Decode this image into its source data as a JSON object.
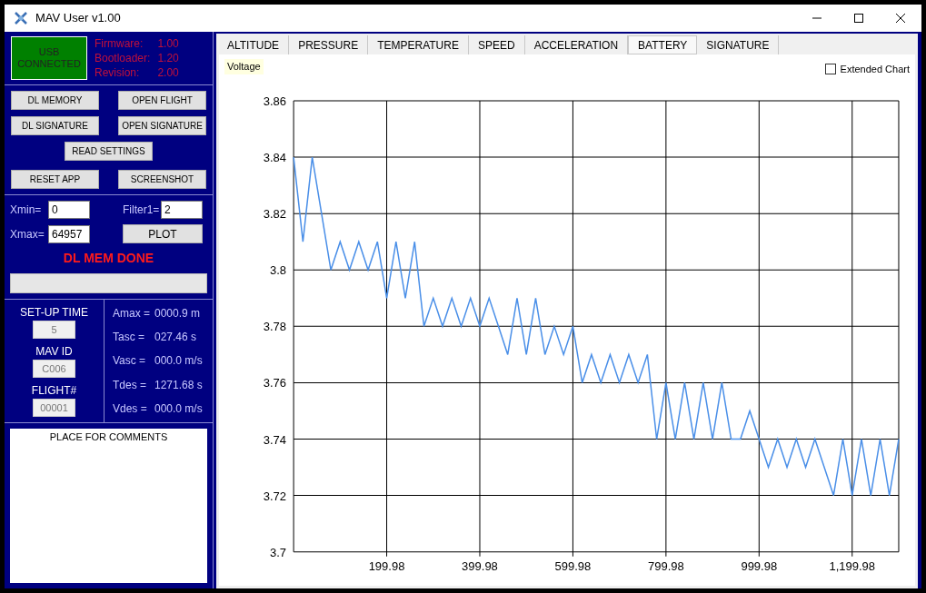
{
  "window": {
    "title": "MAV User v1.00"
  },
  "device": {
    "status": "USB CONNECTED",
    "connected": true
  },
  "versions": [
    {
      "label": "Firmware:",
      "value": "1.00"
    },
    {
      "label": "Bootloader:",
      "value": "1.20"
    },
    {
      "label": "Revision:",
      "value": "2.00"
    }
  ],
  "buttons": [
    [
      "DL MEMORY",
      "OPEN FLIGHT"
    ],
    [
      "DL SIGNATURE",
      "OPEN SIGNATURE"
    ],
    [
      "READ SETTINGS"
    ],
    [
      "RESET APP",
      "SCREENSHOT"
    ]
  ],
  "plot_settings": {
    "xmin": {
      "label": "Xmin=",
      "value": "0"
    },
    "xmax": {
      "label": "Xmax=",
      "value": "64957"
    },
    "filter": {
      "label": "Filter1=",
      "value": "2"
    },
    "plot_button": "PLOT"
  },
  "status_message": "DL MEM DONE",
  "progress": {
    "level": 0
  },
  "settings": [
    {
      "label": "SET-UP TIME",
      "value": "5",
      "disabled": true
    },
    {
      "label": "MAV ID",
      "value": "C006",
      "disabled": true
    },
    {
      "label": "FLIGHT#",
      "value": "00001",
      "disabled": true
    }
  ],
  "results": [
    {
      "label": "Amax =",
      "value": "0000.9 m"
    },
    {
      "label": "Tasc =",
      "value": "027.46 s"
    },
    {
      "label": "Vasc =",
      "value": "000.0 m/s"
    },
    {
      "label": "Tdes =",
      "value": "1271.68 s"
    },
    {
      "label": "Vdes =",
      "value": "000.0 m/s"
    }
  ],
  "comments": {
    "title": "PLACE FOR COMMENTS"
  },
  "tabs": [
    {
      "label": "ALTITUDE",
      "selected": false
    },
    {
      "label": "PRESSURE",
      "selected": false
    },
    {
      "label": "TEMPERATURE",
      "selected": false
    },
    {
      "label": "SPEED",
      "selected": false
    },
    {
      "label": "ACCELERATION",
      "selected": false
    },
    {
      "label": "BATTERY",
      "selected": true
    },
    {
      "label": "SIGNATURE",
      "selected": false
    }
  ],
  "chart": {
    "extended_chart": {
      "label": "Extended Chart",
      "checked": false
    },
    "chart_data": {
      "type": "line",
      "x": [
        0,
        20,
        40,
        60,
        80,
        100,
        120,
        140,
        160,
        180,
        200,
        220,
        240,
        260,
        280,
        300,
        320,
        340,
        360,
        380,
        400,
        420,
        440,
        460,
        480,
        500,
        520,
        540,
        560,
        580,
        600,
        620,
        640,
        660,
        680,
        700,
        720,
        740,
        760,
        780,
        800,
        820,
        840,
        860,
        880,
        900,
        920,
        940,
        960,
        980,
        1000,
        1020,
        1040,
        1060,
        1080,
        1100,
        1120,
        1140,
        1160,
        1180,
        1200,
        1220,
        1240,
        1260,
        1280,
        1300
      ],
      "series": [
        {
          "name": "Voltage",
          "color": "#4a8fe8",
          "values": [
            3.84,
            3.81,
            3.84,
            3.82,
            3.8,
            3.81,
            3.8,
            3.81,
            3.8,
            3.81,
            3.79,
            3.81,
            3.79,
            3.81,
            3.78,
            3.79,
            3.78,
            3.79,
            3.78,
            3.79,
            3.78,
            3.79,
            3.78,
            3.77,
            3.79,
            3.77,
            3.79,
            3.77,
            3.78,
            3.77,
            3.78,
            3.76,
            3.77,
            3.76,
            3.77,
            3.76,
            3.77,
            3.76,
            3.77,
            3.74,
            3.76,
            3.74,
            3.76,
            3.74,
            3.76,
            3.74,
            3.76,
            3.74,
            3.74,
            3.75,
            3.74,
            3.73,
            3.74,
            3.73,
            3.74,
            3.73,
            3.74,
            3.73,
            3.72,
            3.74,
            3.72,
            3.74,
            3.72,
            3.74,
            3.72,
            3.74
          ]
        }
      ],
      "grid": true,
      "xlim": [
        0,
        1300
      ],
      "ylim": [
        3.7,
        3.86
      ],
      "xticks": [
        199.98,
        399.98,
        599.98,
        799.98,
        999.98,
        {
          "value": 1199.98,
          "label": "1,199.98"
        }
      ],
      "yticks": [
        {
          "value": 3.7,
          "label": "3.7"
        },
        {
          "value": 3.72,
          "label": "3.72"
        },
        {
          "value": 3.74,
          "label": "3.74"
        },
        {
          "value": 3.76,
          "label": "3.76"
        },
        {
          "value": 3.78,
          "label": "3.78"
        },
        {
          "value": 3.8,
          "label": "3.8"
        },
        {
          "value": 3.82,
          "label": "3.82"
        },
        {
          "value": 3.84,
          "label": "3.84"
        },
        {
          "value": 3.86,
          "label": "3.86"
        }
      ]
    }
  }
}
